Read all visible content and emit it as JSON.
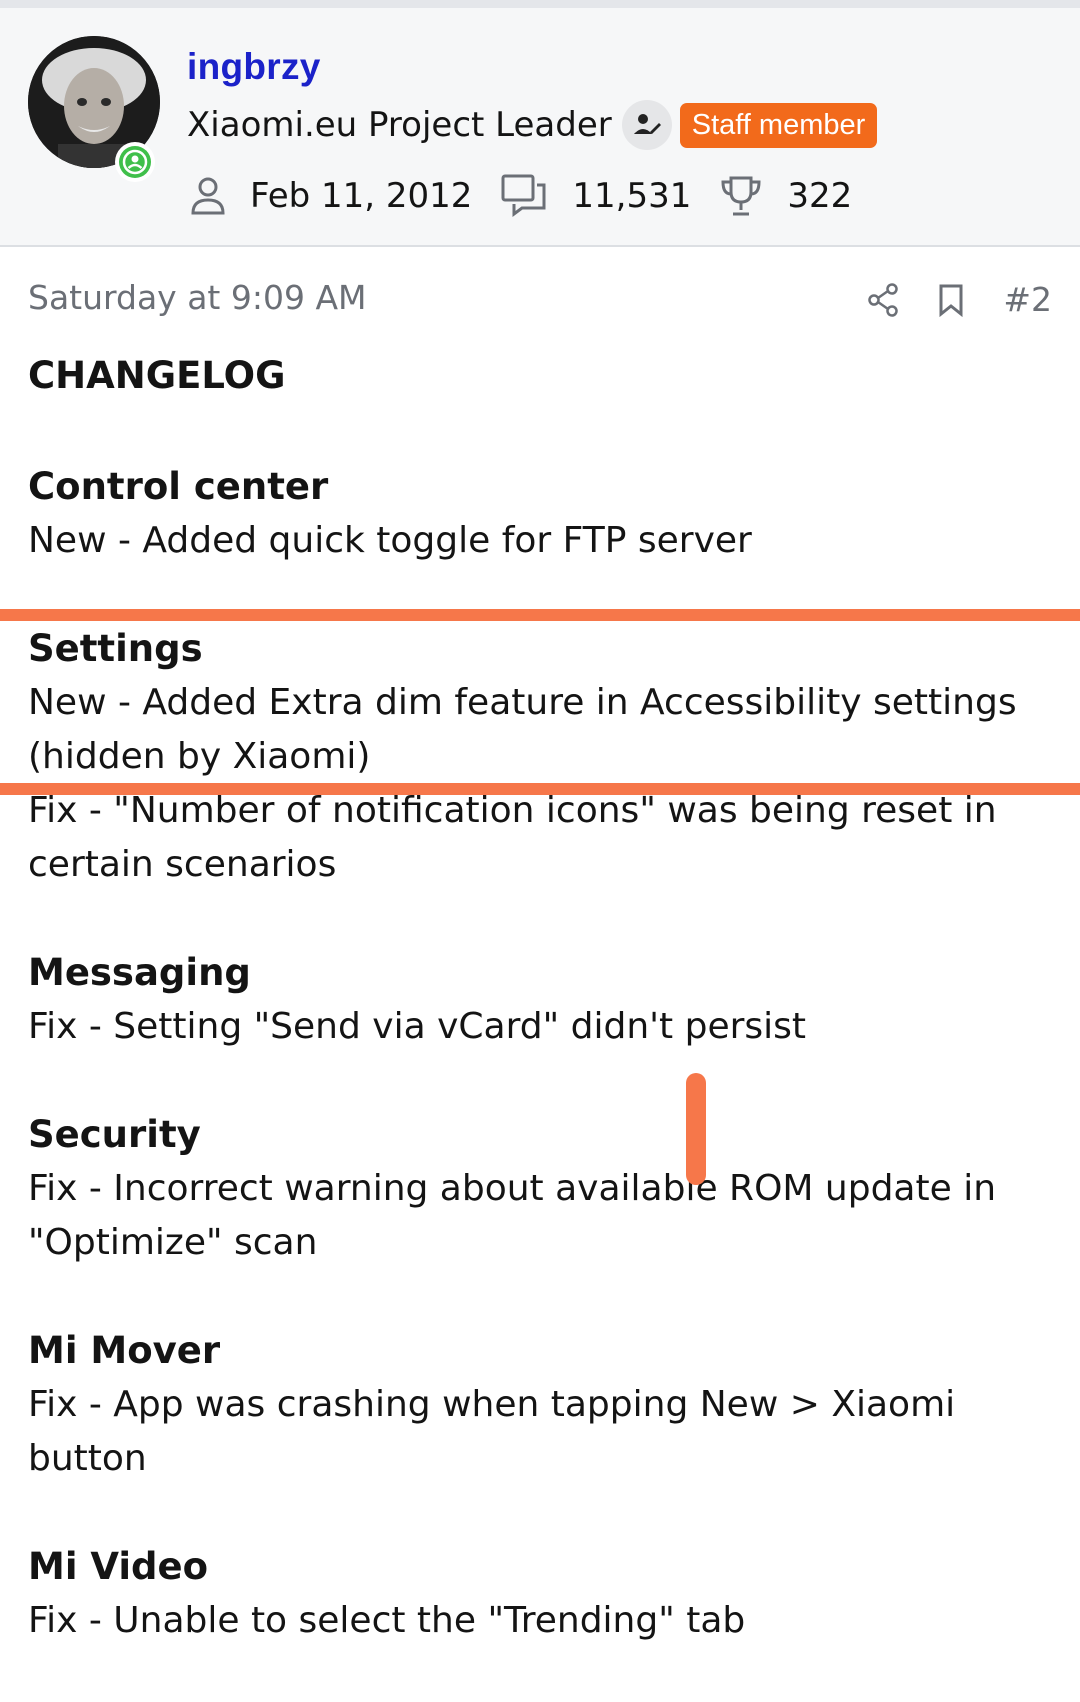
{
  "user": {
    "username": "ingbrzy",
    "title": "Xiaomi.eu Project Leader",
    "badge": "Staff member",
    "joined": "Feb 11, 2012",
    "messages": "11,531",
    "trophies": "322"
  },
  "post": {
    "timestamp": "Saturday at 9:09 AM",
    "number": "#2",
    "heading": "CHANGELOG",
    "sections": [
      {
        "title": "Control center",
        "entries": [
          "New - Added quick toggle for FTP server"
        ]
      },
      {
        "title": "Settings",
        "entries": [
          "New - Added Extra dim feature in Accessibility settings (hidden by Xiaomi)",
          "Fix - \"Number of notification icons\" was being reset in certain scenarios"
        ]
      },
      {
        "title": "Messaging",
        "entries": [
          "Fix - Setting \"Send via vCard\" didn't persist"
        ]
      },
      {
        "title": "Security",
        "entries": [
          "Fix - Incorrect warning about available ROM update in \"Optimize\" scan"
        ]
      },
      {
        "title": "Mi Mover",
        "entries": [
          "Fix - App was crashing when tapping New > Xiaomi button"
        ]
      },
      {
        "title": "Mi Video",
        "entries": [
          "Fix - Unable to select the \"Trending\" tab"
        ]
      }
    ]
  },
  "colors": {
    "username": "#1b22c9",
    "staff_badge": "#f26a1b",
    "online": "#3fbf4a",
    "markup": "#f6774a"
  },
  "icons": [
    "online-status-icon",
    "moderator-icon",
    "user-icon",
    "messages-icon",
    "trophy-icon",
    "share-icon",
    "bookmark-icon"
  ]
}
